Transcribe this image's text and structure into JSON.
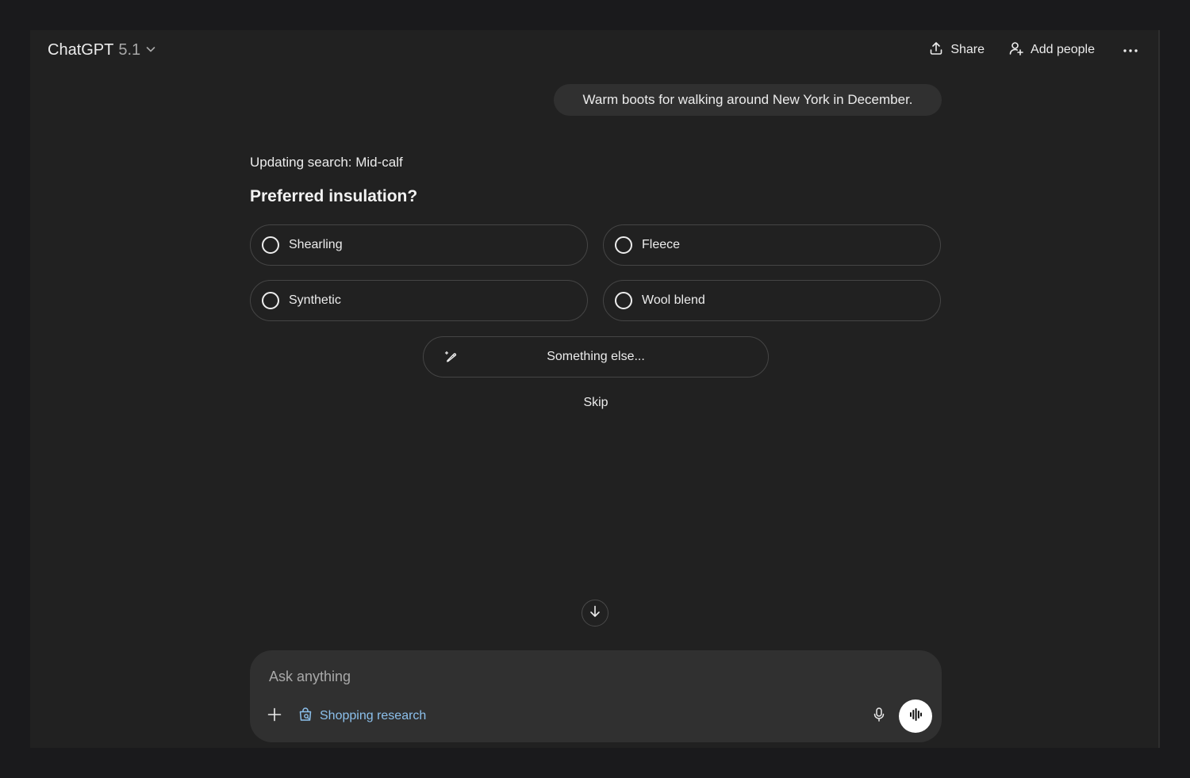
{
  "header": {
    "model_name": "ChatGPT",
    "model_version": "5.1",
    "share_label": "Share",
    "add_people_label": "Add people"
  },
  "conversation": {
    "user_message": "Warm boots for walking around New York in December.",
    "status_line": "Updating search: Mid-calf",
    "question": "Preferred insulation?",
    "options": [
      {
        "label": "Shearling"
      },
      {
        "label": "Fleece"
      },
      {
        "label": "Synthetic"
      },
      {
        "label": "Wool blend"
      }
    ],
    "something_else_label": "Something else...",
    "skip_label": "Skip"
  },
  "composer": {
    "placeholder": "Ask anything",
    "shopping_label": "Shopping research"
  },
  "icons": {
    "chevron": "chevron-down-icon",
    "share": "share-icon",
    "add_people": "add-person-icon",
    "more": "more-dots-icon",
    "pen": "pencil-icon",
    "scroll": "arrow-down-icon",
    "plus": "plus-icon",
    "shopping": "shopping-bag-icon",
    "mic": "microphone-icon",
    "voice": "voice-waveform-icon"
  },
  "colors": {
    "background": "#212121",
    "bubble": "#303030",
    "accent_link": "#8cc0ec"
  }
}
